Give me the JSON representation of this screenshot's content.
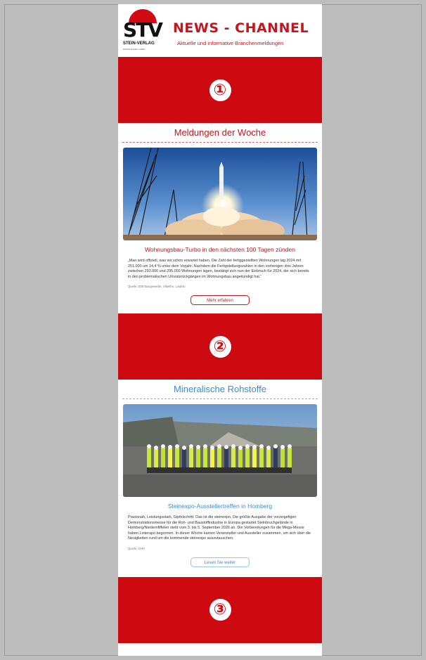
{
  "header": {
    "logo_letters": "STV",
    "logo_name": "STEIN-VERLAG",
    "logo_sub": "BADEN-BADEN GMBH",
    "title": "NEWS - CHANNEL",
    "subtitle": "Aktuelle und informative Branchenmeldungen"
  },
  "bands": [
    "①",
    "②",
    "③"
  ],
  "sections": [
    {
      "heading": "Meldungen der Woche",
      "article_title": "Wohnungsbau-Turbo in den nächsten 100 Tagen zünden",
      "article_text": "„Man wird offiziell, was wir schon erwartet haben. Die Zahl der fertiggestellten Wohnungen lag 2024 mit 251.000 um 14,4 % unter dem Vorjahr. Nachdem die Fertigstellungszahlen in den vorherigen drei Jahren zwischen 293.000 und 295.000 Wohnungen lagen, bestätigt sich nun der Einbruch für 2024, der sich bereits in den problematischen Umsatzrückgängen im Wohnungsbau angekündigt hat.“",
      "source": "Quelle: ZDB Baugewerbe, Ullaelfre, Lindero",
      "button": "Mehr erfahren"
    },
    {
      "heading": "Mineralische Rohstoffe",
      "article_title": "Steinexpo-Ausstellertreffen in Homberg",
      "article_text": "Praxisnah, Leistungsstark, Gipfelschritt: Das ist die steinexpo, Die größte Ausgabe der vorzeigefigen Demonstrationsmesse für die Roh- und Baustoffindustrie in Europa gestartet Steinbruchgelände in Homberg/Niedernfiffelen steht vom 3. bis 5. September 2026 an. Die Vorbereitungen für die Mega-Messe haben Linterapo begonnen. In dieser Woche kamen Veranstalter und Aussteller zusammen, um sich über die Neuigkeiten rund um die kommende steinexpo auszutauschen.",
      "source": "Quelle: GHH",
      "button": "Lesen Sie weiter"
    }
  ],
  "colors": {
    "brand_red": "#cc0a0f",
    "heading_red": "#c4161c",
    "heading_blue": "#3a8bd6",
    "page_grey": "#bdbdbd"
  },
  "icons": [
    "rocket-launch-photo",
    "group-quarry-photo"
  ]
}
